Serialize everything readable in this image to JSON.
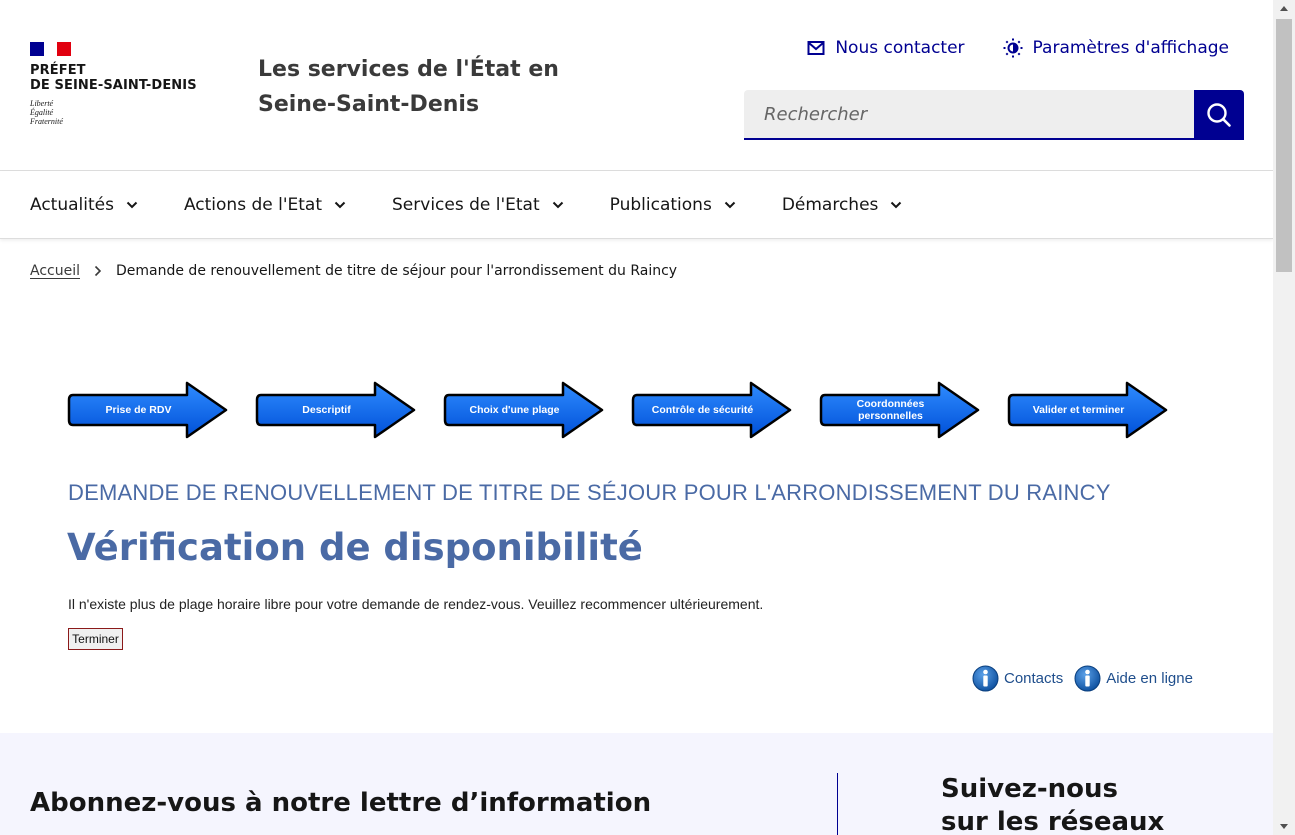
{
  "colors": {
    "accent": "#000091",
    "title_blue": "#4a6aa5",
    "step_blue": "#0a6cf0",
    "footer_bg": "#f5f5fe"
  },
  "header": {
    "logo": {
      "line1": "PRÉFET",
      "line2": "DE SEINE-SAINT-DENIS",
      "motto1": "Liberté",
      "motto2": "Égalité",
      "motto3": "Fraternité"
    },
    "site_title_line1": "Les services de l'État en",
    "site_title_line2": "Seine-Saint-Denis",
    "tools": {
      "contact_label": "Nous contacter",
      "contact_icon": "mail-icon",
      "display_label": "Paramètres d'affichage",
      "display_icon": "brightness-icon"
    },
    "search": {
      "placeholder": "Rechercher",
      "button_icon": "search-icon"
    }
  },
  "nav": {
    "items": [
      {
        "label": "Actualités"
      },
      {
        "label": "Actions de l'Etat"
      },
      {
        "label": "Services de l'Etat"
      },
      {
        "label": "Publications"
      },
      {
        "label": "Démarches"
      }
    ]
  },
  "breadcrumb": {
    "home": "Accueil",
    "current": "Demande de renouvellement de titre de séjour pour l'arrondissement du Raincy"
  },
  "steps": [
    {
      "label": "Prise de RDV"
    },
    {
      "label": "Descriptif"
    },
    {
      "label": "Choix d'une plage"
    },
    {
      "label": "Contrôle de sécurité"
    },
    {
      "label": "Coordonnées personnelles"
    },
    {
      "label": "Valider et terminer"
    }
  ],
  "content": {
    "procedure_title": "DEMANDE DE RENOUVELLEMENT DE TITRE DE SÉJOUR POUR L'ARRONDISSEMENT DU RAINCY",
    "main_title": "Vérification de disponibilité",
    "message": "Il n'existe plus de plage horaire libre pour votre demande de rendez-vous. Veuillez recommencer ultérieurement.",
    "finish_button": "Terminer",
    "contacts_label": "Contacts",
    "help_label": "Aide en ligne"
  },
  "footer": {
    "newsletter_title": "Abonnez-vous à notre lettre d’information",
    "social_title_line1": "Suivez-nous",
    "social_title_line2": "sur les réseaux sociaux"
  }
}
